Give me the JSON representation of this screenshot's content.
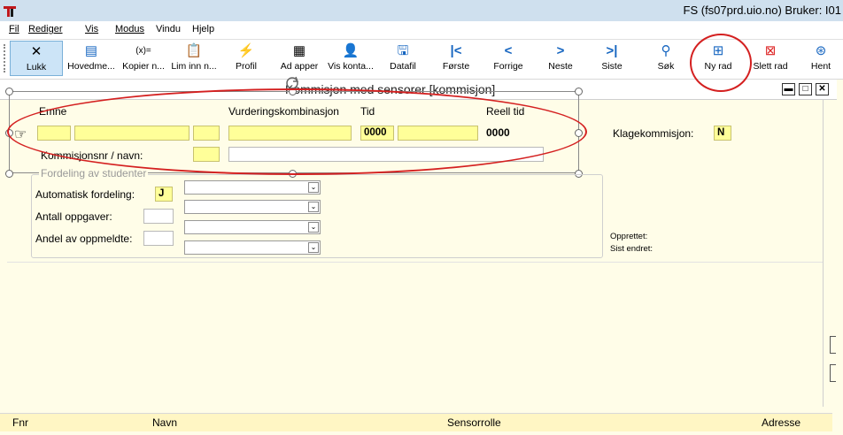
{
  "window": {
    "title": "FS (fs07prd.uio.no) Bruker: I01"
  },
  "menu": [
    "Fil",
    "Rediger",
    "Vis",
    "Modus",
    "Vindu",
    "Hjelp"
  ],
  "toolbar": {
    "lukk": "Lukk",
    "hovedmeny": "Hovedme...",
    "kopier": "Kopier n...",
    "lim": "Lim inn n...",
    "profil": "Profil",
    "ad_apper": "Ad  apper",
    "vis_konta": "Vis konta...",
    "datafil": "Datafil",
    "forste": "Første",
    "forrige": "Forrige",
    "neste": "Neste",
    "siste": "Siste",
    "sok": "Søk",
    "ny_rad": "Ny rad",
    "slett_rad": "Slett rad",
    "hent": "Hent"
  },
  "form": {
    "title": "Kommisjon med sensorer [kommisjon]",
    "headers": {
      "emne": "Emne",
      "vurdering": "Vurderingskombinasjon",
      "tid": "Tid",
      "reell_tid": "Reell tid"
    },
    "tid_value": "0000",
    "reell_tid_value": "0000",
    "klagekommisjon_label": "Klagekommisjon:",
    "klagekommisjon_value": "N",
    "kommisjonsnr_label": "Kommisjonsnr / navn:",
    "fordeling_legend": "Fordeling av studenter",
    "automatisk_label": "Automatisk fordeling:",
    "automatisk_value": "J",
    "antall_label": "Antall oppgaver:",
    "andel_label": "Andel av oppmeldte:",
    "opprettet_label": "Opprettet:",
    "sist_endret_label": "Sist endret:"
  },
  "table_header": {
    "fnr": "Fnr",
    "navn": "Navn",
    "sensorrolle": "Sensorrolle",
    "adresse": "Adresse"
  },
  "colors": {
    "annotation": "#d42020",
    "required_field": "#ffff99",
    "form_bg": "#fffde8"
  }
}
